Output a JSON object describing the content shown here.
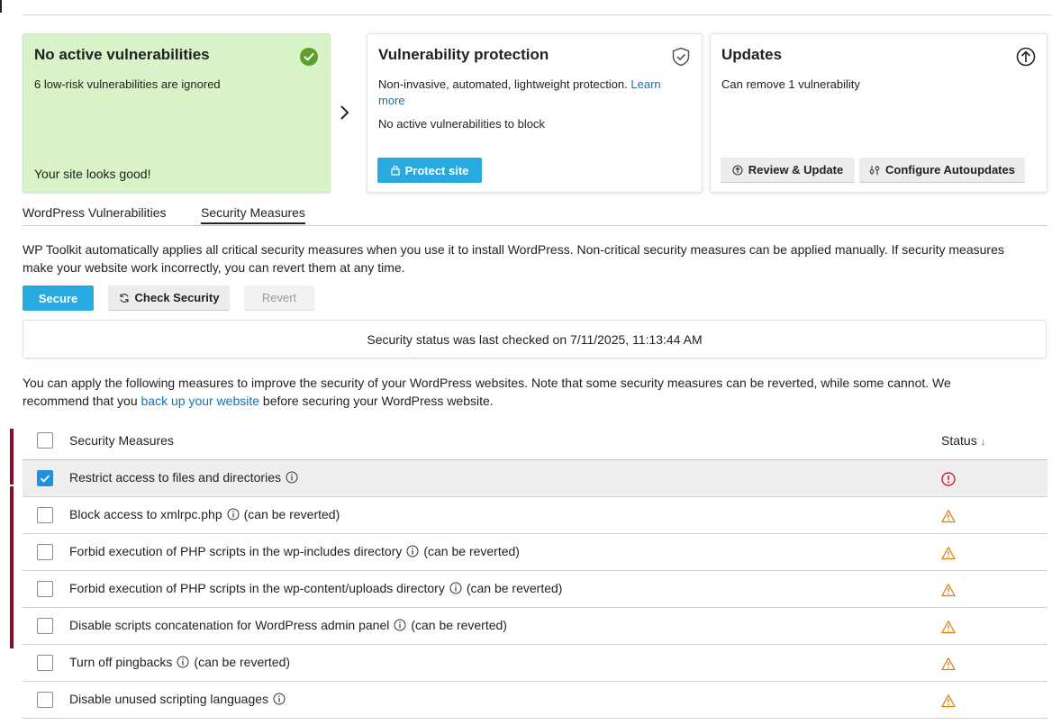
{
  "cards": {
    "status": {
      "title": "No active vulnerabilities",
      "subtitle": "6 low-risk vulnerabilities are ignored",
      "footer": "Your site looks good!",
      "icon": "check-circle-icon",
      "color": "#5aa02c"
    },
    "protection": {
      "title": "Vulnerability protection",
      "description": "Non-invasive, automated, lightweight protection.",
      "learn_more": "Learn more",
      "status_text": "No active vulnerabilities to block",
      "button_label": "Protect site",
      "icon": "shield-check-icon"
    },
    "updates": {
      "title": "Updates",
      "description": "Can remove 1 vulnerability",
      "review_button": "Review & Update",
      "autoupdates_button": "Configure Autoupdates",
      "icon": "upload-arrow-icon"
    }
  },
  "tabs": [
    {
      "label": "WordPress Vulnerabilities",
      "active": false
    },
    {
      "label": "Security Measures",
      "active": true
    }
  ],
  "intro_text": "WP Toolkit automatically applies all critical security measures when you use it to install WordPress. Non-critical security measures can be applied manually. If security measures make your website work incorrectly, you can revert them at any time.",
  "actions": {
    "secure": "Secure",
    "check_security": "Check Security",
    "revert": "Revert"
  },
  "last_checked": "Security status was last checked on 7/11/2025, 11:13:44 AM",
  "apply_text": {
    "before": "You can apply the following measures to improve the security of your WordPress websites. Note that some security measures can be reverted, while some cannot. We recommend that you ",
    "link": "back up your website",
    "after": " before securing your WordPress website."
  },
  "table": {
    "header": {
      "name": "Security Measures",
      "status": "Status",
      "sort_indicator": "↓"
    },
    "rows": [
      {
        "label": "Restrict access to files and directories",
        "note": "",
        "checked": true,
        "status": "error"
      },
      {
        "label": "Block access to xmlrpc.php",
        "note": "(can be reverted)",
        "checked": false,
        "status": "warning"
      },
      {
        "label": "Forbid execution of PHP scripts in the wp-includes directory",
        "note": "(can be reverted)",
        "checked": false,
        "status": "warning"
      },
      {
        "label": "Forbid execution of PHP scripts in the wp-content/uploads directory",
        "note": "(can be reverted)",
        "checked": false,
        "status": "warning"
      },
      {
        "label": "Disable scripts concatenation for WordPress admin panel",
        "note": "(can be reverted)",
        "checked": false,
        "status": "warning"
      },
      {
        "label": "Turn off pingbacks",
        "note": "(can be reverted)",
        "checked": false,
        "status": "warning"
      },
      {
        "label": "Disable unused scripting languages",
        "note": "",
        "checked": false,
        "status": "warning"
      }
    ]
  },
  "colors": {
    "accent": "#28aae1",
    "link": "#0f73b8",
    "error": "#d0021b",
    "warning": "#e07b00",
    "success_bg": "#d9f2c8"
  }
}
